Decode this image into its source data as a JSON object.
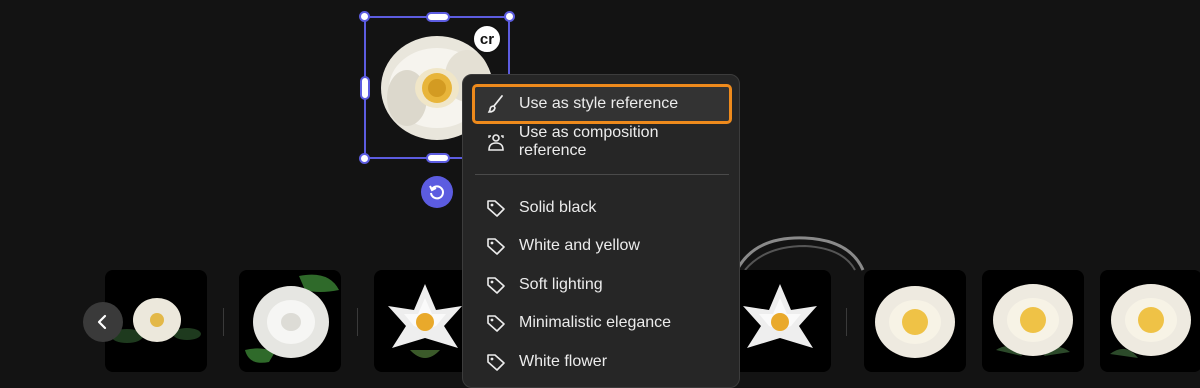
{
  "selected_image": {
    "badge_text": "cr",
    "icons": {
      "badge": "content-credentials-icon",
      "rotate": "rotate-icon"
    }
  },
  "context_menu": {
    "items": [
      {
        "label": "Use as style reference",
        "icon": "brush-icon"
      },
      {
        "label": "Use as composition reference",
        "icon": "composition-icon"
      }
    ],
    "tags": [
      {
        "label": "Solid black",
        "icon": "tag-icon"
      },
      {
        "label": "White and yellow",
        "icon": "tag-icon"
      },
      {
        "label": "Soft lighting",
        "icon": "tag-icon"
      },
      {
        "label": "Minimalistic elegance",
        "icon": "tag-icon"
      },
      {
        "label": "White flower",
        "icon": "tag-icon"
      }
    ],
    "highlight_color": "#ee8a1c"
  },
  "thumbnail_strip": {
    "prev_icon": "chevron-left-icon",
    "thumbnails": [
      "white camellia",
      "white camellia with leaves",
      "white lotus",
      "white lotus",
      "white camellia",
      "white camellia",
      "white camellia"
    ]
  },
  "colors": {
    "background": "#131313",
    "selection": "#5c5ce0",
    "menu_bg": "#262626"
  }
}
